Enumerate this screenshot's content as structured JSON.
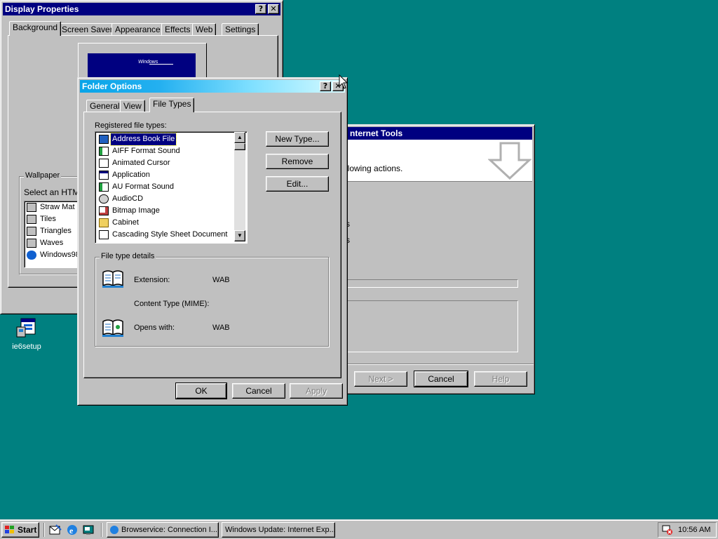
{
  "colors": {
    "desktop": "#008080",
    "selection": "#000080",
    "face": "#c0c0c0"
  },
  "display_properties": {
    "title": "Display Properties",
    "tabs": [
      "Background",
      "Screen Saver",
      "Appearance",
      "Effects",
      "Web",
      "Settings"
    ],
    "preview_text": "Windows",
    "wallpaper_group": "Wallpaper",
    "select_label": "Select an HTML",
    "wallpapers": [
      "Straw Mat",
      "Tiles",
      "Triangles",
      "Waves",
      "Windows98"
    ]
  },
  "folder_options": {
    "title": "Folder Options",
    "help_glyph": "?",
    "close_glyph": "✕",
    "tabs": [
      "General",
      "View",
      "File Types"
    ],
    "registered_label": "Registered file types:",
    "file_types": [
      {
        "label": "Address Book File",
        "icon": "address-book-icon",
        "selected": true
      },
      {
        "label": "AIFF Format Sound",
        "icon": "sound-file-icon"
      },
      {
        "label": "Animated Cursor",
        "icon": "cursor-file-icon"
      },
      {
        "label": "Application",
        "icon": "application-icon"
      },
      {
        "label": "AU Format Sound",
        "icon": "sound-file-icon"
      },
      {
        "label": "AudioCD",
        "icon": "cd-icon"
      },
      {
        "label": "Bitmap Image",
        "icon": "bitmap-icon"
      },
      {
        "label": "Cabinet",
        "icon": "cabinet-folder-icon"
      },
      {
        "label": "Cascading Style Sheet Document",
        "icon": "css-document-icon"
      }
    ],
    "buttons": {
      "new_type": "New Type...",
      "remove": "Remove",
      "edit": "Edit..."
    },
    "details_group": "File type details",
    "extension_label": "Extension:",
    "extension_value": "WAB",
    "content_type_label": "Content Type (MIME):",
    "opens_with_label": "Opens with:",
    "opens_with_value": "WAB",
    "footer": {
      "ok": "OK",
      "cancel": "Cancel",
      "apply": "Apply"
    }
  },
  "update_wizard": {
    "title": "nternet Tools",
    "body_text": "llowing actions.",
    "stub_a": "s",
    "stub_b": "s",
    "buttons": {
      "next": "Next >",
      "cancel": "Cancel",
      "help": "Help"
    }
  },
  "desktop_icons": [
    {
      "label": "ie6setup",
      "icon": "setup-program-icon"
    }
  ],
  "taskbar": {
    "start": "Start",
    "quick_launch": [
      "outlook-express-icon",
      "internet-explorer-icon",
      "show-desktop-icon"
    ],
    "tasks": [
      "Browservice: Connection I...",
      "Windows Update: Internet Exp..."
    ],
    "clock": "10:56 AM"
  }
}
